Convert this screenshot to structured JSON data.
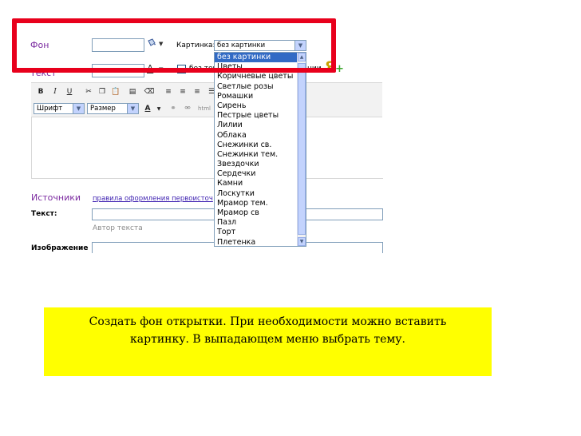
{
  "form": {
    "bg_label": "Фон",
    "text_label": "Текст",
    "picture_label": "Картинка:",
    "picture_selected": "без картинки",
    "no_text_fragment": "без тек",
    "no_text_suffix": "нии",
    "sources_label": "Источники",
    "sources_link": "правила оформления первоисточ",
    "text_field_label": "Текст:",
    "author_placeholder": "Автор текста",
    "image_label": "Изображение"
  },
  "toolbar": {
    "bold": "B",
    "italic": "I",
    "underline": "U",
    "font_select": "Шрифт",
    "size_select": "Размер",
    "font_color_glyph": "A",
    "html_glyph": "html"
  },
  "dropdown": {
    "items": [
      "без картинки",
      "Цветы",
      "Коричневые цветы",
      "Светлые розы",
      "Ромашки",
      "Сирень",
      "Пестрые цветы",
      "Лилии",
      "Облака",
      "Снежинки св.",
      "Снежинки тем.",
      "Звездочки",
      "Сердечки",
      "Камни",
      "Лоскутки",
      "Мрамор тем.",
      "Мрамор св",
      "Пазл",
      "Торт",
      "Плетенка"
    ],
    "selected_index": 0
  },
  "caption": {
    "line1": "Создать  фон открытки. При необходимости можно вставить",
    "line2": "картинку. В выпадающем меню выбрать тему."
  },
  "colors": {
    "highlight_border": "#e8001c",
    "caption_bg": "#ffff00",
    "selection": "#316ac5"
  }
}
